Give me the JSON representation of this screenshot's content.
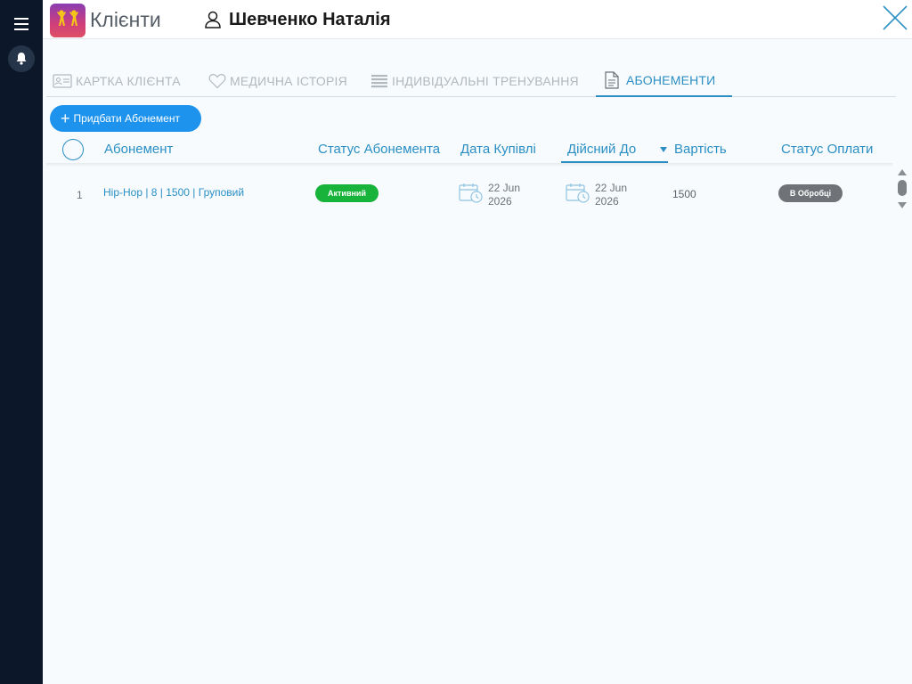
{
  "header": {
    "app_title": "Клієнти",
    "client_name": "Шевченко Наталія"
  },
  "tabs": [
    {
      "label": "КАРТКА КЛІЄНТА",
      "icon": "id-card-icon",
      "active": false
    },
    {
      "label": "МЕДИЧНА ІСТОРІЯ",
      "icon": "heart-icon",
      "active": false
    },
    {
      "label": "ІНДИВІДУАЛЬНІ ТРЕНУВАННЯ",
      "icon": "list-icon",
      "active": false
    },
    {
      "label": "АБОНЕМЕНТИ",
      "icon": "document-icon",
      "active": true
    }
  ],
  "toolbar": {
    "add_label": "Придбати Абонемент"
  },
  "table": {
    "columns": [
      "Абонемент",
      "Статус Абонемента",
      "Дата Купівлі",
      "Дійсний До",
      "Вартість",
      "Статус Оплати"
    ],
    "sorted_column": "Дійсний До",
    "sort_direction": "desc",
    "rows": [
      {
        "num": "1",
        "name": "Hip-Hop | 8 | 1500 | Груповий",
        "status": "Активний",
        "purchase_date_day": "22 Jun",
        "purchase_date_year": "2026",
        "valid_until_day": "22 Jun",
        "valid_until_year": "2026",
        "price": "1500",
        "payment_status": "В Обробці"
      }
    ]
  },
  "colors": {
    "accent": "#2b8fc4",
    "button": "#1d93ee",
    "active": "#18b33b",
    "processing": "#6f7378",
    "sidebar": "#0c1829"
  }
}
